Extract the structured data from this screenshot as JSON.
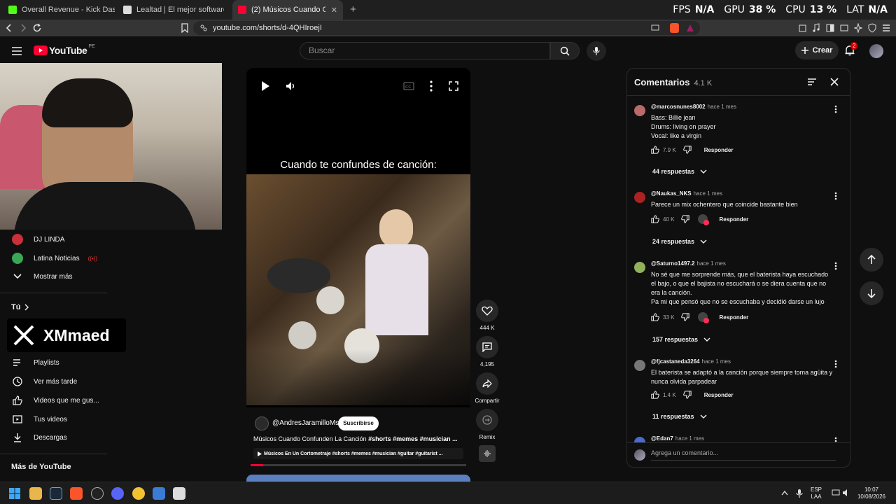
{
  "browser": {
    "tabs": [
      {
        "title": "Overall Revenue - Kick Dashboard",
        "color": "#53fc18"
      },
      {
        "title": "Lealtad | El mejor software para pote",
        "color": "#ffffff"
      },
      {
        "title": "(2) Músicos Cuando Confunden",
        "color": "#ff0033"
      }
    ],
    "new_tab": "+",
    "url": "youtube.com/shorts/d-4QHIroejI",
    "perf": {
      "fps_label": "FPS",
      "fps": "N/A",
      "gpu_label": "GPU",
      "gpu": "38 %",
      "cpu_label": "CPU",
      "cpu": "13 %",
      "lat_label": "LAT",
      "lat": "N/A"
    }
  },
  "yt": {
    "logo": "YouTube",
    "region": "PE",
    "search_placeholder": "Buscar",
    "create_label": "Crear",
    "notif_count": "2"
  },
  "sidebar": {
    "subs": [
      {
        "label": "DJ LINDA",
        "color": "#c9303a"
      },
      {
        "label": "Latina Noticias",
        "color": "#3aa757"
      }
    ],
    "show_more": "Mostrar más",
    "you_title": "Tú",
    "you_items": [
      {
        "label": "Playlists",
        "icon": "playlist-icon"
      },
      {
        "label": "Ver más tarde",
        "icon": "clock-icon"
      },
      {
        "label": "Videos que me gus...",
        "icon": "thumb-up-icon"
      },
      {
        "label": "Tus videos",
        "icon": "video-icon"
      },
      {
        "label": "Descargas",
        "icon": "download-icon"
      }
    ],
    "more_title": "Más de YouTube"
  },
  "overlay": {
    "brand": "XMmaed"
  },
  "short": {
    "caption": "Cuando te confundes de canción:",
    "channel": "@AndresJaramilloMs",
    "subscribe": "Suscribirse",
    "title_prefix": "Músicos Cuando Confunden La Canción ",
    "title_tags": "#shorts #memes #musician ...",
    "playlist": "Músicos En Un Cortometraje #shorts #memes #musician #guitar #guitarist ...",
    "likes": "444 K",
    "comments": "4,195",
    "share": "Compartir",
    "remix": "Remix"
  },
  "comments": {
    "title": "Comentarios",
    "count": "4.1 K",
    "placeholder": "Agrega un comentario...",
    "responder": "Responder",
    "items": [
      {
        "user": "@marcosnunes8002",
        "time": "hace 1 mes",
        "lines": [
          "Bass: Billie jean",
          "Drums: living on prayer",
          "Vocal: like a virgin"
        ],
        "likes": "7.9 K",
        "creator_heart": false,
        "replies": "44 respuestas",
        "color": "#b96a6a"
      },
      {
        "user": "@Naukas_NKS",
        "time": "hace 1 mes",
        "lines": [
          "Parece un mix ochentero que coincide bastante bien"
        ],
        "likes": "40 K",
        "creator_heart": true,
        "replies": "24 respuestas",
        "color": "#a22"
      },
      {
        "user": "@Saturno1497.2",
        "time": "hace 1 mes",
        "lines": [
          "No sé que me sorprende más, que el baterista haya escuchado",
          "el bajo, o que el bajista no escuchará o se diera cuenta que no",
          "era la canción.",
          "Pa mi que pensó que no se escuchaba y decidió darse un lujo"
        ],
        "likes": "33 K",
        "creator_heart": true,
        "replies": "157 respuestas",
        "color": "#8fb25a"
      },
      {
        "user": "@fjcastaneda3264",
        "time": "hace 1 mes",
        "lines": [
          "El baterista se adaptó a la canción porque siempre toma agüita y",
          "nunca olvida parpadear"
        ],
        "likes": "1.4 K",
        "creator_heart": false,
        "replies": "11 respuestas",
        "color": "#777"
      },
      {
        "user": "@Edan7",
        "time": "hace 1 mes",
        "lines": [],
        "likes": "",
        "creator_heart": false,
        "replies": "",
        "color": "#4a6ad0"
      }
    ]
  },
  "taskbar": {
    "lang": "ESP",
    "layout": "LAA",
    "time": "10:07",
    "date": "10/08/2026"
  }
}
